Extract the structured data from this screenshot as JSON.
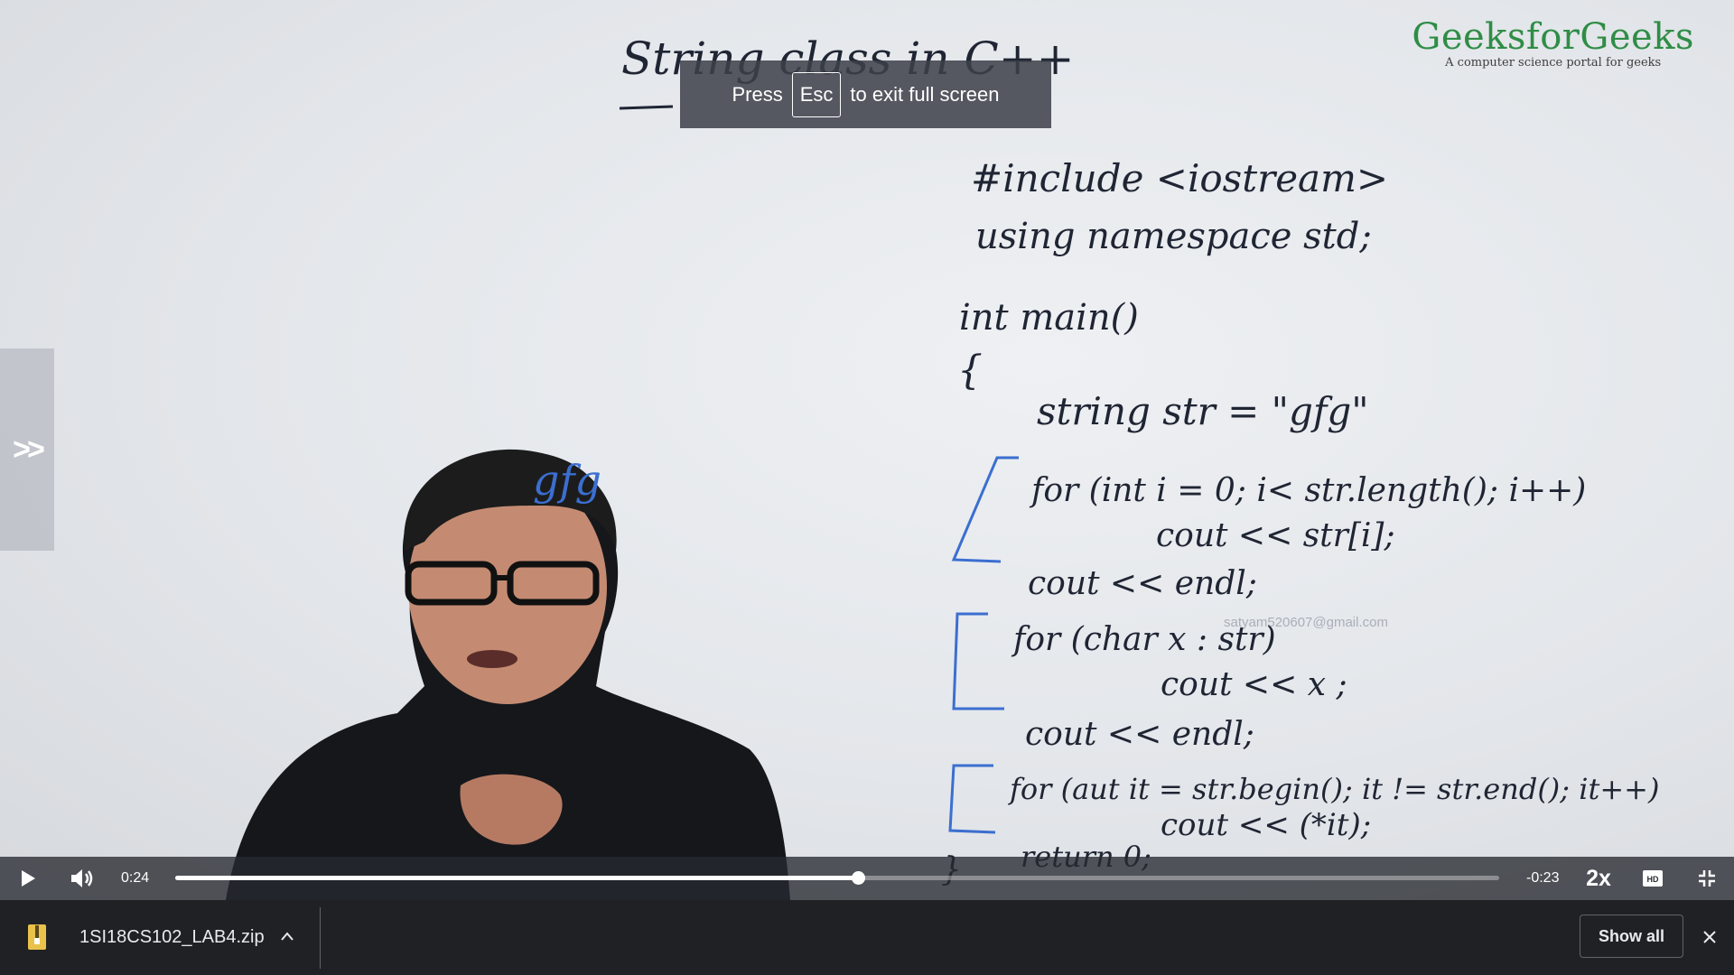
{
  "video": {
    "logo": {
      "name": "GeeksforGeeks",
      "tagline": "A computer science portal for geeks"
    },
    "board": {
      "title": "String class in C++",
      "side_note": "gfg",
      "code_lines": [
        "#include <iostream>",
        "using namespace std;",
        "int main()",
        "{",
        "string str = \"gfg\"",
        "for (int i = 0; i< str.length(); i++)",
        "cout << str[i];",
        "cout << endl;",
        "for (char x : str)",
        "cout << x ;",
        "cout << endl;",
        "for (aut it = str.begin(); it != str.end(); it++)",
        "cout << (*it);",
        "return 0;",
        "}"
      ]
    },
    "watermark": "satyam520607@gmail.com",
    "fullscreen_toast": {
      "before": "Press",
      "key": "Esc",
      "after": "to exit full screen"
    },
    "side_tab_label": ">>",
    "controls": {
      "elapsed": "0:24",
      "remaining": "-0:23",
      "progress": 0.516,
      "speed": "2x",
      "hd_label": "HD"
    }
  },
  "downloads_bar": {
    "file_name": "1SI18CS102_LAB4.zip",
    "show_all": "Show all"
  },
  "colors": {
    "logo_green": "#2f8d46",
    "download_bar": "#202124",
    "marker_blue": "#3b6fd0"
  }
}
